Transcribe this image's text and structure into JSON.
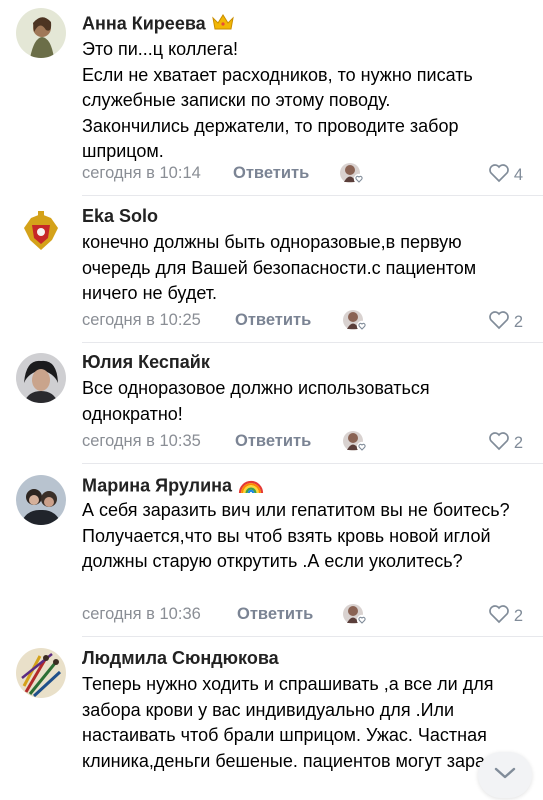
{
  "comments": [
    {
      "author": "Анна Киреева",
      "badge_icon": "crown-icon",
      "text": "Это пи...ц коллега!\nЕсли не хватает расходников, то нужно писать служебные записки по этому поводу.\nЗакончились держатели, то проводите забор шприцом.",
      "time": "сегодня в 10:14",
      "reply_label": "Ответить",
      "likes": "4"
    },
    {
      "author": "Eka Solo",
      "badge_icon": "",
      "text": "конечно должны быть одноразовые,в первую очередь для Вашей безопасности.с пациентом ничего не будет.",
      "time": "сегодня в 10:25",
      "reply_label": "Ответить",
      "likes": "2"
    },
    {
      "author": "Юлия Кеспайк",
      "badge_icon": "",
      "text": "Все одноразовое должно использоваться однократно!",
      "time": "сегодня в 10:35",
      "reply_label": "Ответить",
      "likes": "2"
    },
    {
      "author": "Марина Ярулина",
      "badge_icon": "rainbow-icon",
      "text": "А себя заразить вич или гепатитом вы не боитесь?Получается,что вы чтоб взять кровь новой иглой должны старую открутить .А если уколитесь?",
      "time": "сегодня в 10:36",
      "reply_label": "Ответить",
      "likes": "2"
    },
    {
      "author": "Людмила Сюндюкова",
      "badge_icon": "",
      "text": "Теперь нужно ходить и спрашивать ,а все ли для забора крови у вас индивидуально для .Или настаивать чтоб брали шприцом. Ужас.  Частная  клиника,деньги бешеные. пациентов  могут заразить"
    }
  ],
  "scroll_down_icon": "chevron-down-icon",
  "colors": {
    "meta": "#8a8e95",
    "reply": "#7b8494",
    "likes": "#818c99"
  }
}
